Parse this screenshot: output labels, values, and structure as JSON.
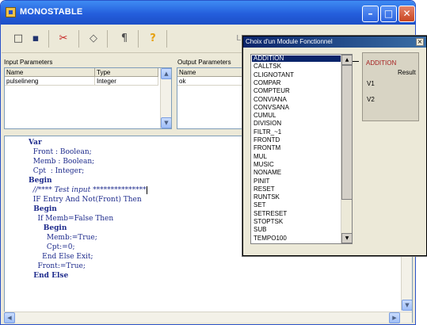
{
  "window": {
    "title": "MONOSTABLE",
    "minimize_glyph": "–",
    "maximize_glyph": "□",
    "close_glyph": "✕"
  },
  "toolbar": {
    "new_icon": "□",
    "save_icon": "▪",
    "cut_icon": "✂",
    "shape_icon": "◇",
    "tool_icon": "¶",
    "help_icon": "?",
    "extra_text": "L"
  },
  "input_params": {
    "label": "Input Parameters",
    "headers": [
      "Name",
      "Type"
    ],
    "rows": [
      [
        "pulselineng",
        "Integer"
      ]
    ]
  },
  "output_params": {
    "label": "Output Parameters",
    "headers": [
      "Name"
    ],
    "rows": [
      [
        "ok"
      ]
    ]
  },
  "code": {
    "lines": [
      "Var",
      "  Front : Boolean;",
      "  Memb : Boolean;",
      "  Cpt  : Integer;",
      "Begin",
      "  //**** Test input ***************",
      "  IF Entry And Not(Front) Then",
      "  Begin",
      "    If Memb=False Then",
      "      Begin",
      "        Memb:=True;",
      "        Cpt:=0;",
      "      End Else Exit;",
      "    Front:=True;",
      "  End Else"
    ]
  },
  "dialog": {
    "title": "Choix d'un Module Fonctionnel",
    "close_glyph": "×",
    "modules": [
      "ADDITION",
      "CALLTSK",
      "CLIGNOTANT",
      "COMPAR",
      "COMPTEUR",
      "CONVIANA",
      "CONVSANA",
      "CUMUL",
      "DIVISION",
      "FILTR_~1",
      "FRONTD",
      "FRONTM",
      "MUL",
      "MUSIC",
      "NONAME",
      "PINIT",
      "RESET",
      "RUNTSK",
      "SET",
      "SETRESET",
      "STOPTSK",
      "SUB",
      "TEMPO100"
    ],
    "selected": "ADDITION",
    "preview": {
      "title": "ADDITION",
      "output": "Result",
      "input1": "V1",
      "input2": "V2"
    }
  },
  "colors": {
    "titlebar": "#245edc",
    "selection": "#0a246a",
    "keyword": "#1e2b8c",
    "type": "#8b1a1a",
    "preview_title": "#a51f1f"
  }
}
